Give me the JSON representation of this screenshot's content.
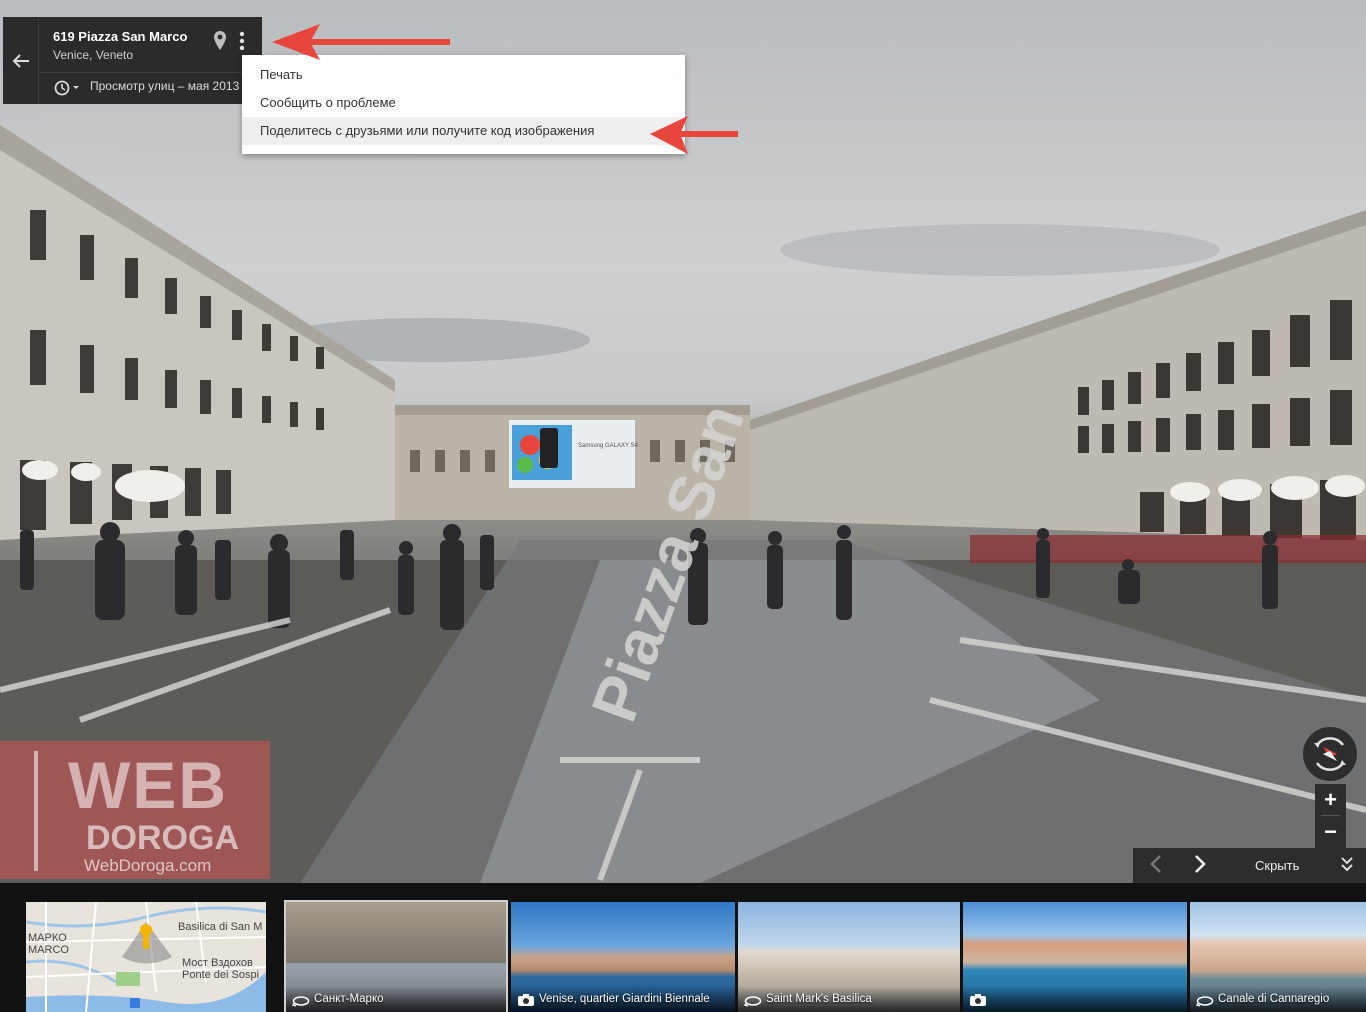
{
  "info_card": {
    "title": "619 Piazza San Marco",
    "subtitle": "Venice, Veneto",
    "history_label": "Просмотр улиц – мая 2013",
    "back_icon": "arrow-left-icon",
    "pin_icon": "map-pin-icon",
    "more_icon": "more-vert-icon",
    "history_icon": "clock-history-icon"
  },
  "menu": {
    "items": [
      {
        "label": "Печать"
      },
      {
        "label": "Сообщить о проблеме"
      },
      {
        "label": "Поделитесь с друзьями или получите код изображения",
        "highlighted": true
      }
    ]
  },
  "watermark": {
    "line1": "WEB",
    "line2": "DOROGA",
    "url": "WebDoroga.com"
  },
  "controls": {
    "zoom_in": "+",
    "zoom_out": "−",
    "compass_icon": "compass-icon"
  },
  "filmstrip": {
    "prev_label": "‹",
    "next_label": "›",
    "hide_label": "Скрыть",
    "collapse_icon": "double-chevron-down-icon",
    "minimap": {
      "labels": [
        "МАРКО",
        "MARCO",
        "Basilica di San M",
        "Мост Вздохов",
        "Ponte dei Sospi"
      ]
    },
    "thumbnails": [
      {
        "label": "Санкт-Марко",
        "icon": "360-icon",
        "selected": true
      },
      {
        "label": "Venise, quartier Giardini Biennale",
        "icon": "camera-icon"
      },
      {
        "label": "Saint Mark's Basilica",
        "icon": "360-icon"
      },
      {
        "label": "",
        "icon": "camera-icon"
      },
      {
        "label": "Canale di Cannaregio",
        "icon": "360-icon"
      }
    ]
  },
  "scene": {
    "ground_text": "Piazza San",
    "billboard_text": "Samsung GALAXY S4"
  },
  "colors": {
    "annotation_red": "#e8453c",
    "panel_dark": "#2b2b2b",
    "watermark": "#d65353"
  }
}
